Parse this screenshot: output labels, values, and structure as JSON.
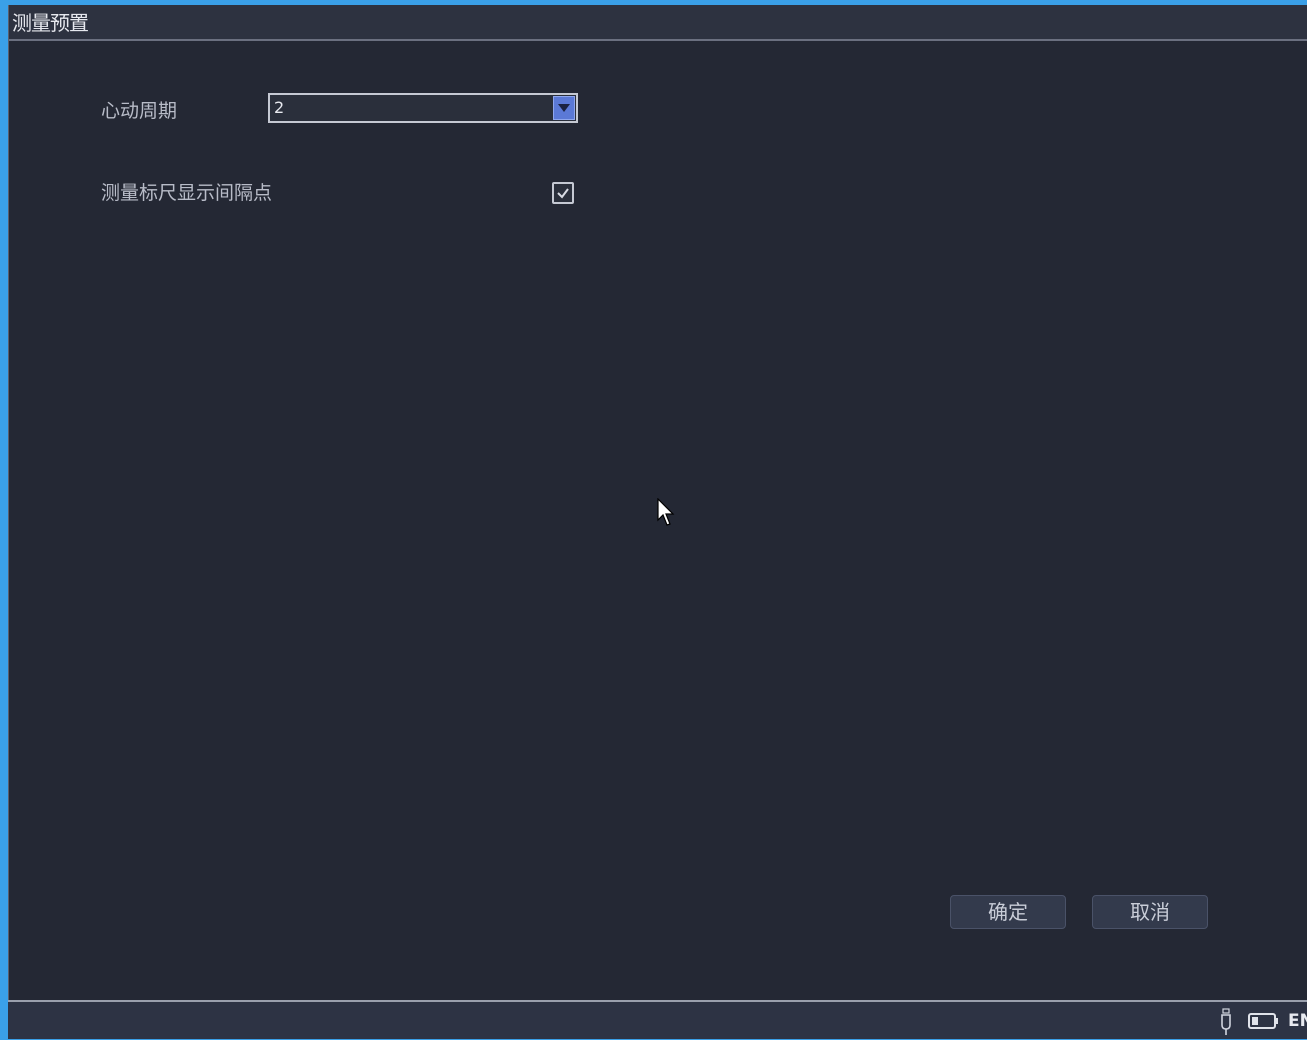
{
  "dialog": {
    "title": "测量预置"
  },
  "settings": {
    "heart_cycle": {
      "label": "心动周期",
      "value": "2"
    },
    "ruler_interval_points": {
      "label": "测量标尺显示间隔点",
      "checked": true
    }
  },
  "buttons": {
    "ok_label": "确定",
    "cancel_label": "取消"
  },
  "status_bar": {
    "usb_icon": "usb-icon",
    "battery_icon": "battery-icon",
    "language": "EN"
  },
  "colors": {
    "dialog_background": "#242834",
    "desktop_background": "#3aa0e8",
    "dropdown_accent": "#5b79d6"
  }
}
